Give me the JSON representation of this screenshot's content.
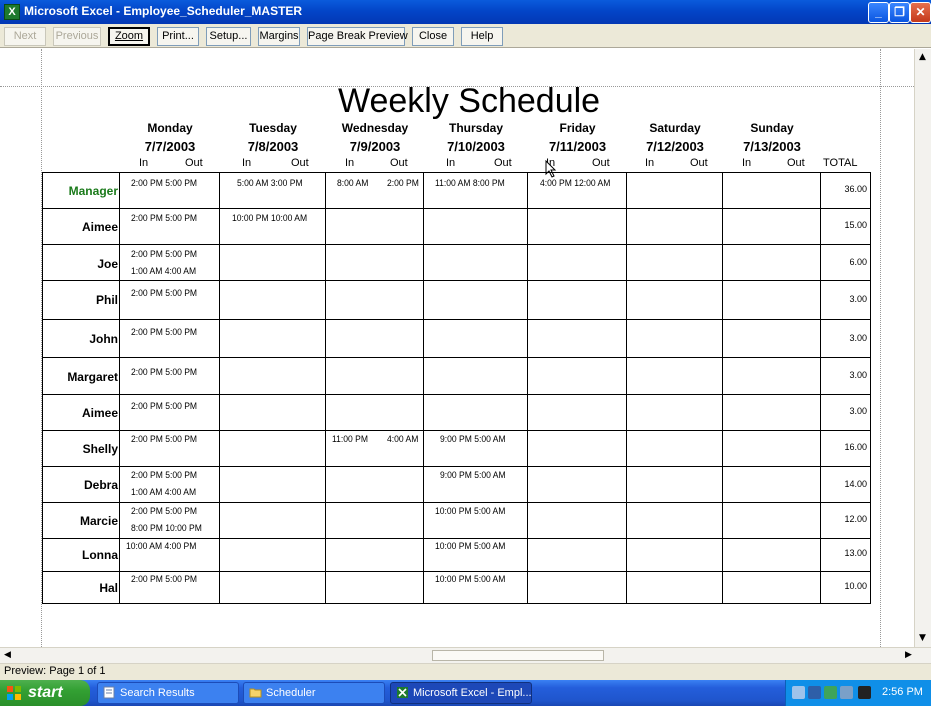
{
  "window": {
    "title": "Microsoft Excel - Employee_Scheduler_MASTER",
    "app_icon": "excel-icon",
    "controls": [
      "minimize-icon",
      "restore-icon",
      "close-icon"
    ]
  },
  "toolbar": {
    "next": "Next",
    "previous": "Previous",
    "zoom": "Zoom",
    "print": "Print...",
    "setup": "Setup...",
    "margins": "Margins",
    "page_break_preview": "Page Break Preview",
    "close": "Close",
    "help": "Help"
  },
  "sheet": {
    "title": "Weekly Schedule",
    "in_label": "In",
    "out_label": "Out",
    "total_label": "TOTAL",
    "days": [
      {
        "name": "Monday",
        "date": "7/7/2003"
      },
      {
        "name": "Tuesday",
        "date": "7/8/2003"
      },
      {
        "name": "Wednesday",
        "date": "7/9/2003"
      },
      {
        "name": "Thursday",
        "date": "7/10/2003"
      },
      {
        "name": "Friday",
        "date": "7/11/2003"
      },
      {
        "name": "Saturday",
        "date": "7/12/2003"
      },
      {
        "name": "Sunday",
        "date": "7/13/2003"
      }
    ],
    "rows": [
      {
        "name": "Manager",
        "total": "36.00",
        "mon": "2:00 PM  5:00 PM",
        "tue": "5:00 AM  3:00 PM",
        "wed_in": "8:00 AM",
        "wed_out": "2:00 PM",
        "thu": "11:00 AM  8:00 PM",
        "fri": "4:00 PM  12:00 AM"
      },
      {
        "name": "Aimee",
        "total": "15.00",
        "mon": "2:00 PM  5:00 PM",
        "tue": "10:00 PM  10:00 AM"
      },
      {
        "name": "Joe",
        "total": "6.00",
        "mon": "2:00 PM  5:00 PM",
        "mon2": "1:00 AM  4:00 AM"
      },
      {
        "name": "Phil",
        "total": "3.00",
        "mon": "2:00 PM  5:00 PM"
      },
      {
        "name": "John",
        "total": "3.00",
        "mon": "2:00 PM  5:00 PM"
      },
      {
        "name": "Margaret",
        "total": "3.00",
        "mon": "2:00 PM  5:00 PM"
      },
      {
        "name": "Aimee",
        "total": "3.00",
        "mon": "2:00 PM  5:00 PM"
      },
      {
        "name": "Shelly",
        "total": "16.00",
        "mon": "2:00 PM  5:00 PM",
        "wed_in": "11:00 PM",
        "wed_out": "4:00 AM",
        "thu": "9:00 PM  5:00 AM"
      },
      {
        "name": "Debra",
        "total": "14.00",
        "mon": "2:00 PM  5:00 PM",
        "mon2": "1:00 AM  4:00 AM",
        "thu": "9:00 PM  5:00 AM"
      },
      {
        "name": "Marcie",
        "total": "12.00",
        "mon": "2:00 PM  5:00 PM",
        "mon2": "8:00 PM  10:00 PM",
        "thu": "10:00 PM  5:00 AM"
      },
      {
        "name": "Lonna",
        "total": "13.00",
        "mon": "10:00 AM  4:00 PM",
        "thu": "10:00 PM  5:00 AM"
      },
      {
        "name": "Hal",
        "total": "10.00",
        "mon": "2:00 PM  5:00 PM",
        "thu": "10:00 PM  5:00 AM"
      }
    ]
  },
  "status": {
    "text": "Preview: Page 1 of 1"
  },
  "taskbar": {
    "start": "start",
    "tasks": [
      "Search Results",
      "Scheduler",
      "Microsoft Excel - Empl..."
    ],
    "clock": "2:56 PM"
  },
  "colors": {
    "manager_name": "#1a7a1a",
    "titlebar": "#0345c8",
    "taskbar": "#245edb",
    "start_button": "#33a033"
  }
}
